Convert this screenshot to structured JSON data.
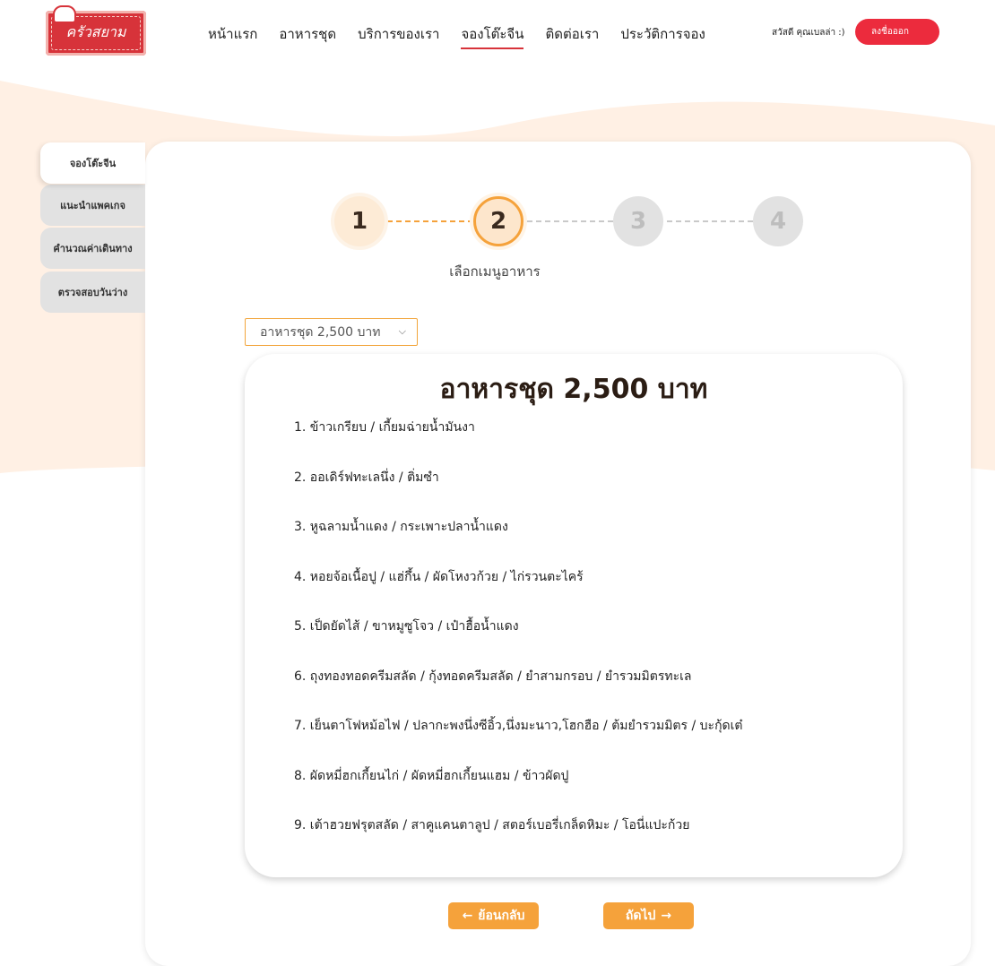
{
  "header": {
    "logo_text": "ครัวสยาม",
    "nav": [
      "หน้าแรก",
      "อาหารชุด",
      "บริการของเรา",
      "จองโต๊ะจีน",
      "ติดต่อเรา",
      "ประวัติการจอง"
    ],
    "active_nav": "จองโต๊ะจีน",
    "greeting": "สวัสดี คุณเบลล่า :)",
    "logout_label": "ลงชื่อออก"
  },
  "sidebar": {
    "items": [
      {
        "label": "จองโต๊ะจีน",
        "active": true
      },
      {
        "label": "แนะนำแพคเกจ",
        "active": false
      },
      {
        "label": "คำนวณค่าเดินทาง",
        "active": false
      },
      {
        "label": "ตรวจสอบวันว่าง",
        "active": false
      }
    ]
  },
  "stepper": {
    "steps": [
      "1",
      "2",
      "3",
      "4"
    ],
    "current": 2,
    "caption": "เลือกเมนูอาหาร"
  },
  "set_select": {
    "value": "อาหารชุด 2,500 บาท"
  },
  "menu": {
    "title": "อาหารชุด 2,500 บาท",
    "items": [
      "1. ข้าวเกรียบ / เกี้ยมฉ่ายน้ำมันงา",
      "2. ออเดิร์ฟทะเลนึ่ง / ติ่มซำ",
      "3. หูฉลามน้ำแดง / กระเพาะปลาน้ำแดง",
      "4. หอยจ้อเนื้อปู / แฮ่กึ้น / ผัดโหงวก้วย / ไก่รวนตะไคร้",
      "5. เป็ดยัดไส้ / ขาหมูซูโจว / เป๋าฮื้อน้ำแดง",
      "6. ถุงทองทอดครีมสลัด / กุ้งทอดครีมสลัด / ยำสามกรอบ / ยำรวมมิตรทะเล",
      "7. เย็นตาโฟหม้อไฟ / ปลากะพงนึ่งซีอิ้ว,นึ่งมะนาว,โฮกฮือ / ต้มยำรวมมิตร / บะกุ้ดเต๋",
      "8. ผัดหมี่ฮกเกี้ยนไก่ / ผัดหมี่ฮกเกี้ยนแฮม / ข้าวผัดปู",
      "9. เต้าฮวยฟรุตสลัด / สาคูแคนตาลูป / สตอร์เบอรี่เกล็ดหิมะ / โอนี่แปะก้วย"
    ]
  },
  "buttons": {
    "back_label": "ย้อนกลับ",
    "next_label": "ถัดไป"
  },
  "colors": {
    "accent": "#f5a23b",
    "danger": "#ec2b3d",
    "background_wave": "#fff0e4"
  }
}
